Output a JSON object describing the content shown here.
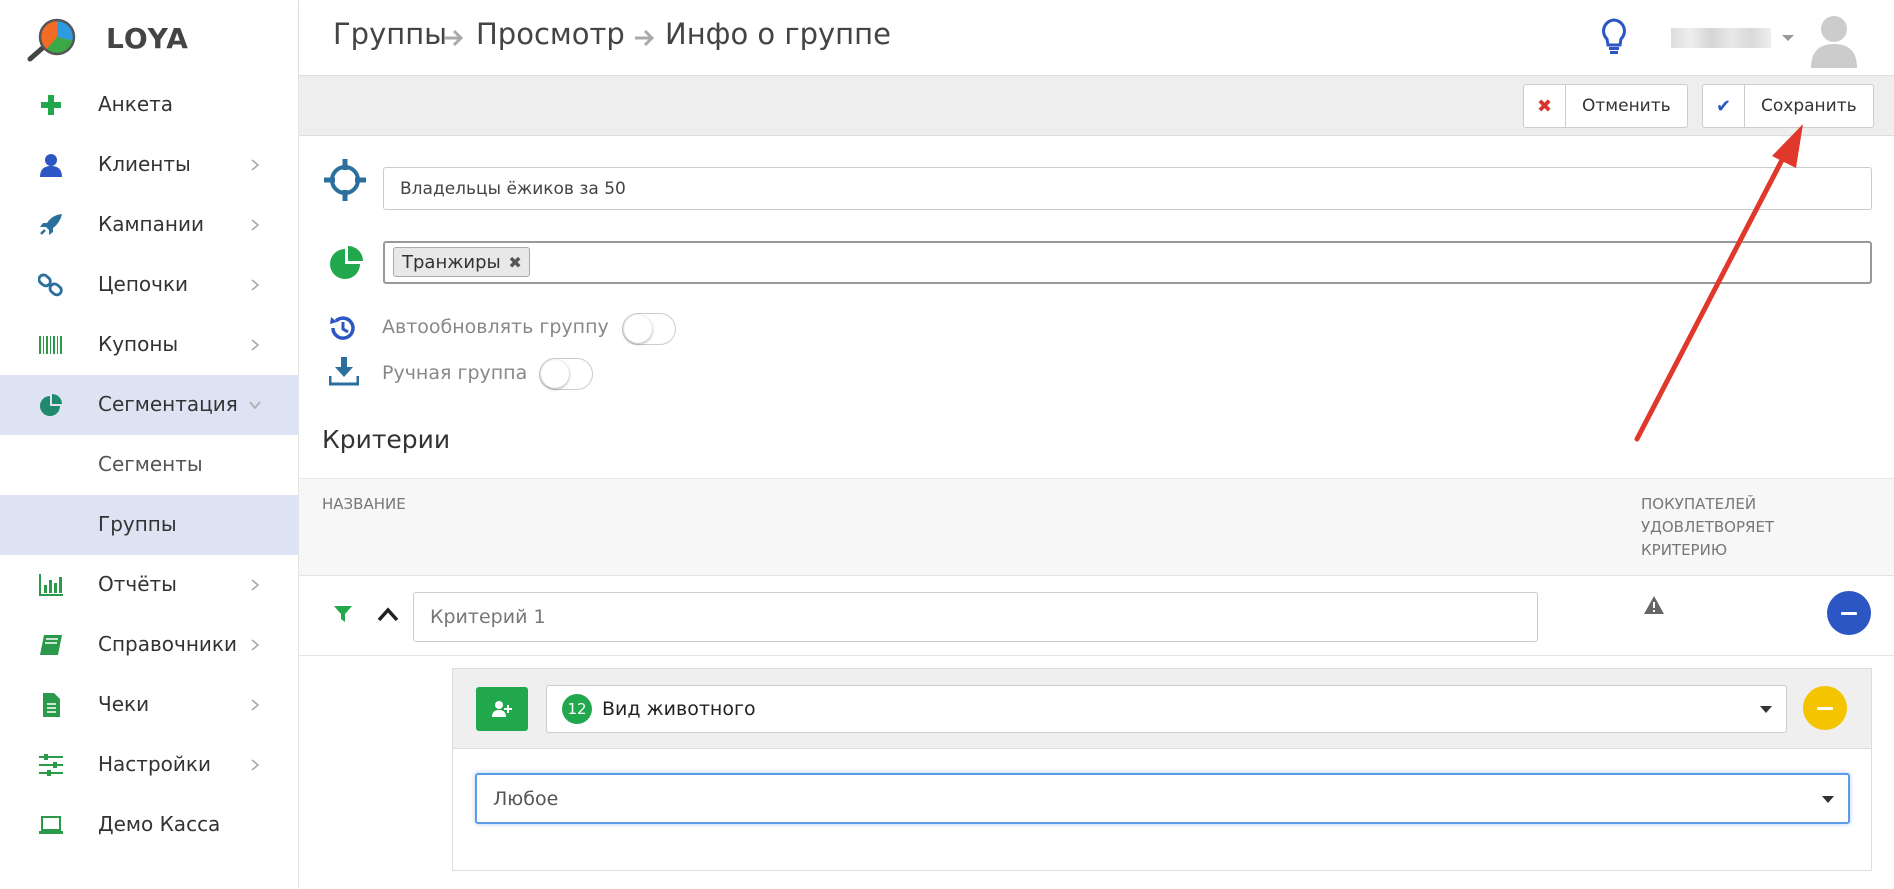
{
  "app": {
    "name": "LOYA"
  },
  "sidebar": {
    "items": [
      {
        "label": "Анкета",
        "icon": "plus-icon",
        "chevron": false,
        "active": false
      },
      {
        "label": "Клиенты",
        "icon": "user-icon",
        "chevron": true,
        "active": false
      },
      {
        "label": "Кампании",
        "icon": "rocket-icon",
        "chevron": true,
        "active": false
      },
      {
        "label": "Цепочки",
        "icon": "link-icon",
        "chevron": true,
        "active": false
      },
      {
        "label": "Купоны",
        "icon": "barcode-icon",
        "chevron": true,
        "active": false
      },
      {
        "label": "Сегментация",
        "icon": "pie-chart-icon",
        "chevron": true,
        "active": true,
        "expanded": true
      },
      {
        "label": "Сегменты",
        "sub": true,
        "active": false
      },
      {
        "label": "Группы",
        "sub": true,
        "active": true
      },
      {
        "label": "Отчёты",
        "icon": "bar-chart-icon",
        "chevron": true,
        "active": false
      },
      {
        "label": "Справочники",
        "icon": "book-icon",
        "chevron": true,
        "active": false
      },
      {
        "label": "Чеки",
        "icon": "receipt-icon",
        "chevron": true,
        "active": false
      },
      {
        "label": "Настройки",
        "icon": "sliders-icon",
        "chevron": true,
        "active": false
      },
      {
        "label": "Демо Касса",
        "icon": "laptop-icon",
        "chevron": false,
        "active": false
      }
    ]
  },
  "header": {
    "breadcrumb": [
      "Группы",
      "Просмотр",
      "Инфо о группе"
    ]
  },
  "toolbar": {
    "cancel_label": "Отменить",
    "save_label": "Сохранить"
  },
  "form": {
    "group_name_value": "Владельцы ёжиков за 50",
    "tag": "Транжиры",
    "auto_update_label": "Автообновлять группу",
    "manual_group_label": "Ручная группа"
  },
  "criteria": {
    "title": "Критерии",
    "col_name": "Название",
    "col_buyers_line1": "Покупателей",
    "col_buyers_line2": "удовлетворяет",
    "col_buyers_line3": "критерию",
    "criterion_name": "Критерий 1",
    "condition": {
      "badge": "12",
      "attribute": "Вид животного",
      "value": "Любое"
    }
  },
  "colors": {
    "accent_green": "#21a84c",
    "accent_blue": "#2c56c4",
    "accent_yellow": "#f5c400",
    "active_bg": "#dde3f3",
    "arrow_red": "#e0392b"
  }
}
